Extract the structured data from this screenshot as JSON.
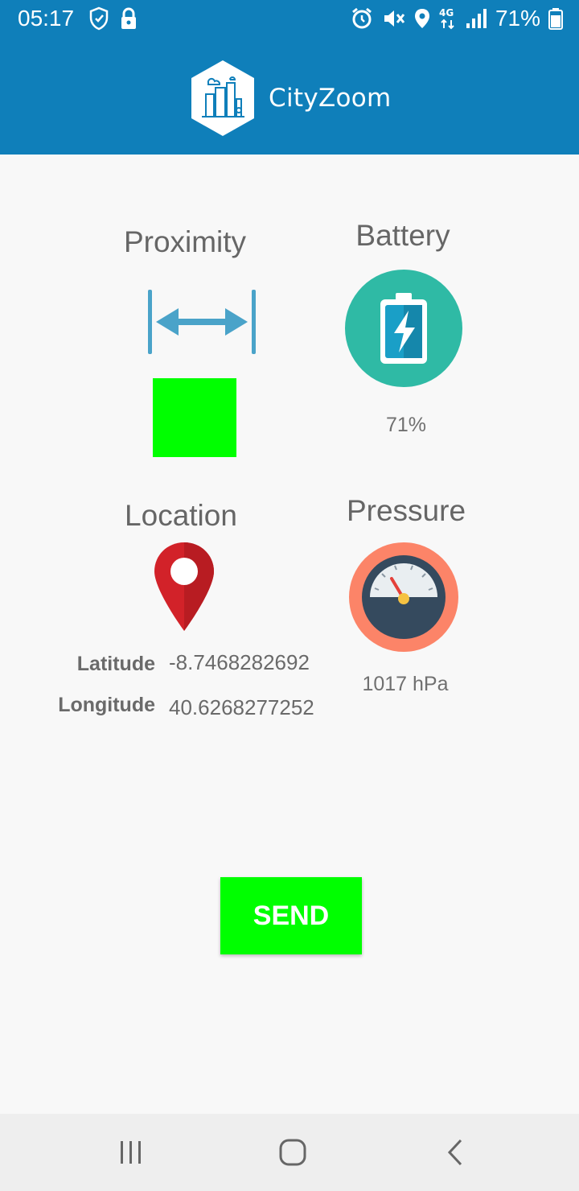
{
  "status_bar": {
    "time": "05:17",
    "battery_percent": "71%",
    "icons_left": [
      "shield-icon",
      "lock-icon"
    ],
    "icons_right": [
      "alarm-icon",
      "mute-icon",
      "location-icon",
      "4g-icon",
      "signal-icon",
      "battery-icon"
    ]
  },
  "header": {
    "app_name": "CityZoom",
    "color": "#0f7fba"
  },
  "sensors": {
    "proximity": {
      "label": "Proximity",
      "indicator_color": "#00ff00"
    },
    "battery": {
      "label": "Battery",
      "value": "71%"
    },
    "location": {
      "label": "Location",
      "latitude_label": "Latitude",
      "latitude_value": "-8.7468282692",
      "longitude_label": "Longitude",
      "longitude_value": "40.6268277252"
    },
    "pressure": {
      "label": "Pressure",
      "value": "1017 hPa"
    }
  },
  "actions": {
    "send_label": "SEND",
    "send_color": "#00ff00"
  },
  "nav_bar": {
    "buttons": [
      "recent-apps",
      "home",
      "back"
    ]
  }
}
